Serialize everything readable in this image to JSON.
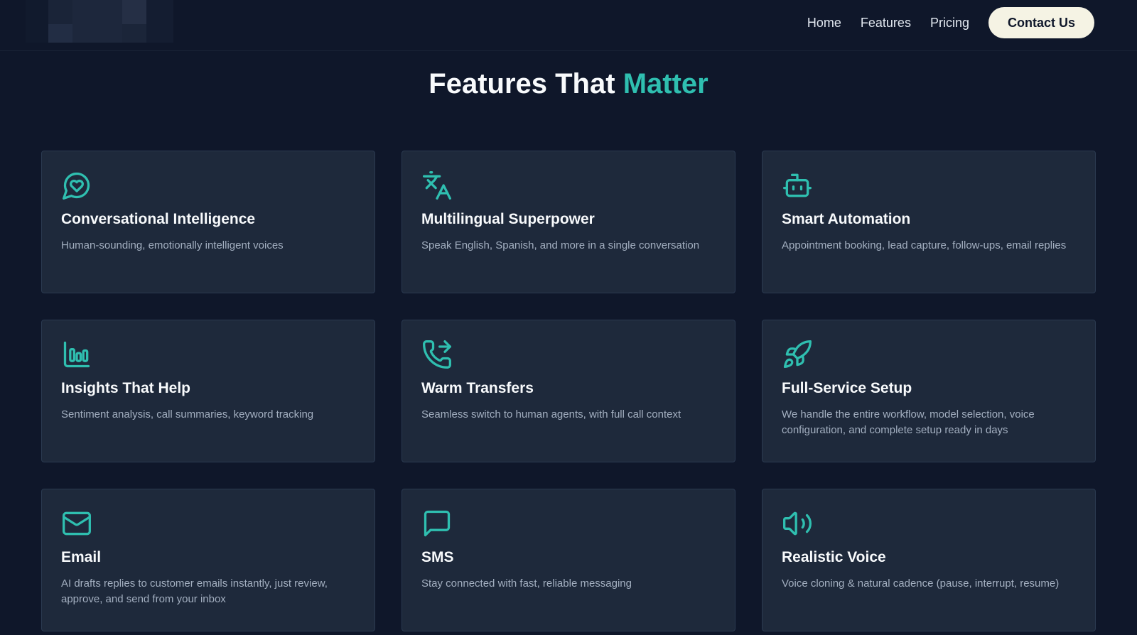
{
  "nav": {
    "links": [
      "Home",
      "Features",
      "Pricing"
    ],
    "cta": "Contact Us"
  },
  "section": {
    "title_main": "Features That",
    "title_accent": "Matter"
  },
  "colors": {
    "background": "#0f172a",
    "card": "#1e293b",
    "accent": "#2fbfb0",
    "cta_background": "#f5f3e4"
  },
  "features": [
    {
      "icon": "heart-chat-icon",
      "title": "Conversational Intelligence",
      "desc": "Human-sounding, emotionally intelligent voices"
    },
    {
      "icon": "translate-icon",
      "title": "Multilingual Superpower",
      "desc": "Speak English, Spanish, and more in a single conversation"
    },
    {
      "icon": "robot-icon",
      "title": "Smart Automation",
      "desc": "Appointment booking, lead capture, follow-ups, email replies"
    },
    {
      "icon": "bar-chart-icon",
      "title": "Insights That Help",
      "desc": "Sentiment analysis, call summaries, keyword tracking"
    },
    {
      "icon": "phone-forward-icon",
      "title": "Warm Transfers",
      "desc": "Seamless switch to human agents, with full call context"
    },
    {
      "icon": "rocket-icon",
      "title": "Full-Service Setup",
      "desc": "We handle the entire workflow, model selection, voice configuration, and complete setup ready in days"
    },
    {
      "icon": "mail-icon",
      "title": "Email",
      "desc": "AI drafts replies to customer emails instantly, just review, approve, and send from your inbox"
    },
    {
      "icon": "message-square-icon",
      "title": "SMS",
      "desc": "Stay connected with fast, reliable messaging"
    },
    {
      "icon": "speaker-icon",
      "title": "Realistic Voice",
      "desc": "Voice cloning & natural cadence (pause, interrupt, resume)"
    }
  ]
}
